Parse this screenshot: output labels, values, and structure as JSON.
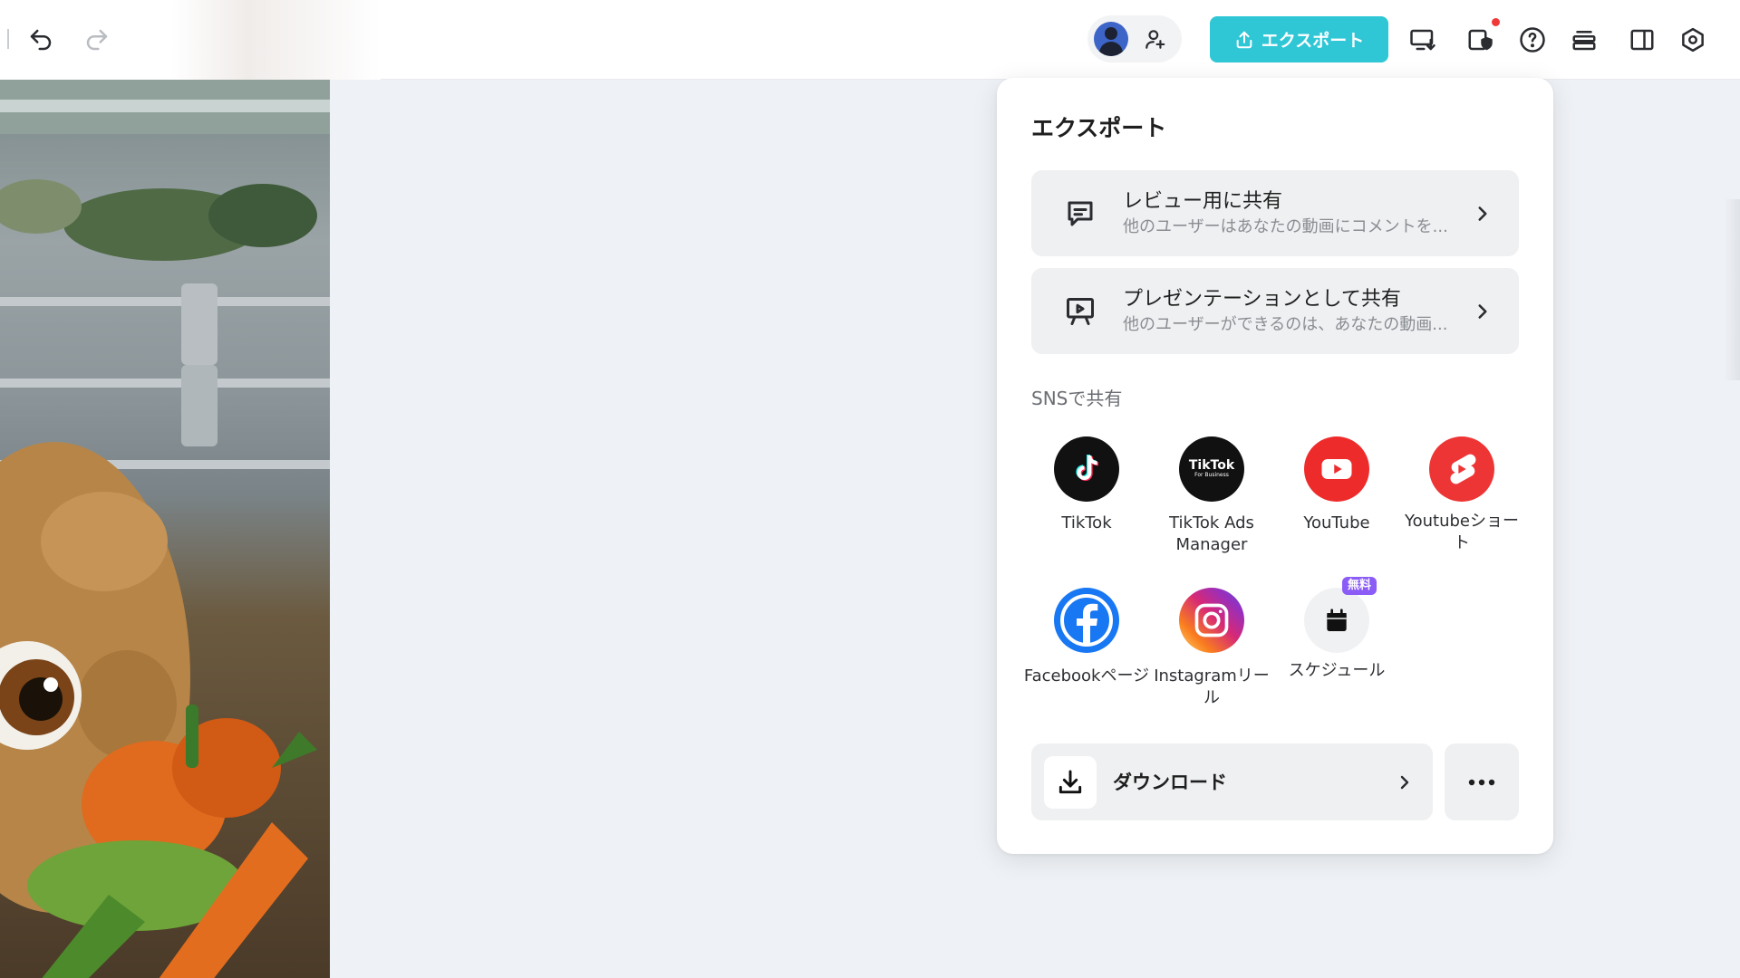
{
  "toolbar": {
    "undo_icon": "undo-icon",
    "redo_icon": "redo-icon",
    "export_label": "エクスポート",
    "icons": [
      "avatar",
      "add-user-icon",
      "export-upload-icon",
      "present-download-icon",
      "shield-check-icon",
      "help-icon",
      "layers-icon",
      "split-panel-icon",
      "settings-icon"
    ],
    "accent": "#2fc6d6",
    "notification_color": "#f03a3a"
  },
  "export_panel": {
    "title": "エクスポート",
    "review_share": {
      "title": "レビュー用に共有",
      "subtitle": "他のユーザーはあなたの動画にコメントを..."
    },
    "presentation_share": {
      "title": "プレゼンテーションとして共有",
      "subtitle": "他のユーザーができるのは、あなたの動画..."
    },
    "sns_label": "SNSで共有",
    "sns_items": [
      {
        "name": "TikTok",
        "color": "#111111"
      },
      {
        "name": "TikTok Ads Manager",
        "logo_text": "TikTok",
        "logo_sub": "For Business",
        "color": "#111111"
      },
      {
        "name": "YouTube",
        "color": "#ee2b2b"
      },
      {
        "name": "Youtubeショート",
        "color": "#ee3535"
      },
      {
        "name": "Facebookページ",
        "color": "#1877f2"
      },
      {
        "name": "Instagramリール",
        "color": "#d6249f"
      },
      {
        "name": "スケジュール",
        "badge": "無料",
        "color": "#f0f1f3"
      }
    ],
    "download_label": "ダウンロード",
    "more_icon": "more-horizontal-icon"
  }
}
